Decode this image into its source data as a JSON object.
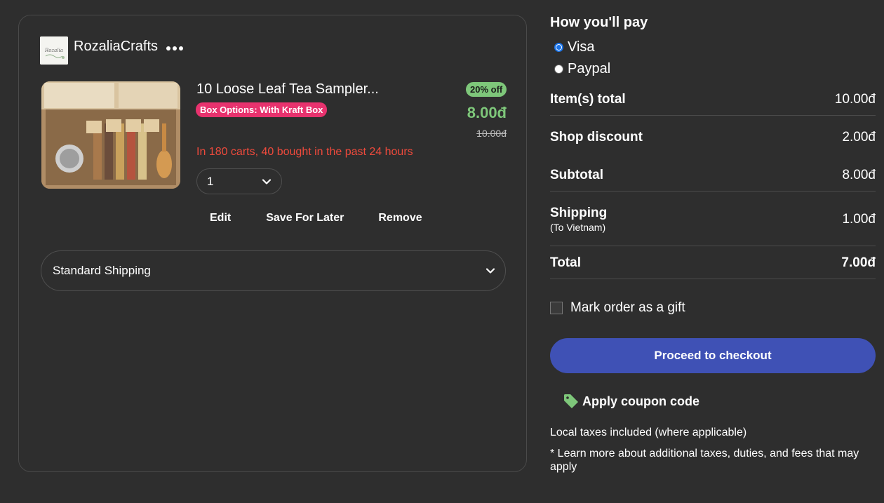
{
  "shop": {
    "name": "RozaliaCrafts",
    "logo_text": "Rozalia"
  },
  "item": {
    "title": "10 Loose Leaf Tea Sampler...",
    "variant": "Box Options: With Kraft Box",
    "discount": "20% off",
    "price": "8.00đ",
    "original_price": "10.00đ",
    "social_proof": "In 180 carts, 40 bought in the past 24 hours",
    "quantity": "1",
    "actions": {
      "edit": "Edit",
      "save_later": "Save For Later",
      "remove": "Remove"
    }
  },
  "shipping": {
    "method": "Standard Shipping"
  },
  "payment": {
    "heading": "How you'll pay",
    "options": [
      {
        "label": "Visa",
        "selected": true
      },
      {
        "label": "Paypal",
        "selected": false
      }
    ]
  },
  "summary": {
    "items_total": {
      "label": "Item(s) total",
      "value": "10.00đ"
    },
    "shop_discount": {
      "label": "Shop discount",
      "value": "2.00đ"
    },
    "subtotal": {
      "label": "Subtotal",
      "value": "8.00đ"
    },
    "shipping": {
      "label": "Shipping",
      "sub": "(To Vietnam)",
      "value": "1.00đ"
    },
    "total": {
      "label": "Total",
      "value": "7.00đ"
    }
  },
  "gift": {
    "label": "Mark order as a gift",
    "checked": false
  },
  "checkout": {
    "label": "Proceed to checkout"
  },
  "coupon": {
    "label": "Apply coupon code"
  },
  "notes": {
    "taxes": "Local taxes included (where applicable)",
    "more": "* Learn more about additional taxes, duties, and fees that may apply"
  },
  "colors": {
    "background": "#2e2e2e",
    "accent_button": "#3f51b5",
    "price_green": "#7ec77a",
    "variant_pink": "#e8326e",
    "alert_red": "#ef4a3c"
  },
  "icons": {
    "more": "more-dots-icon",
    "chevron": "chevron-down-icon",
    "coupon": "tag-icon"
  }
}
